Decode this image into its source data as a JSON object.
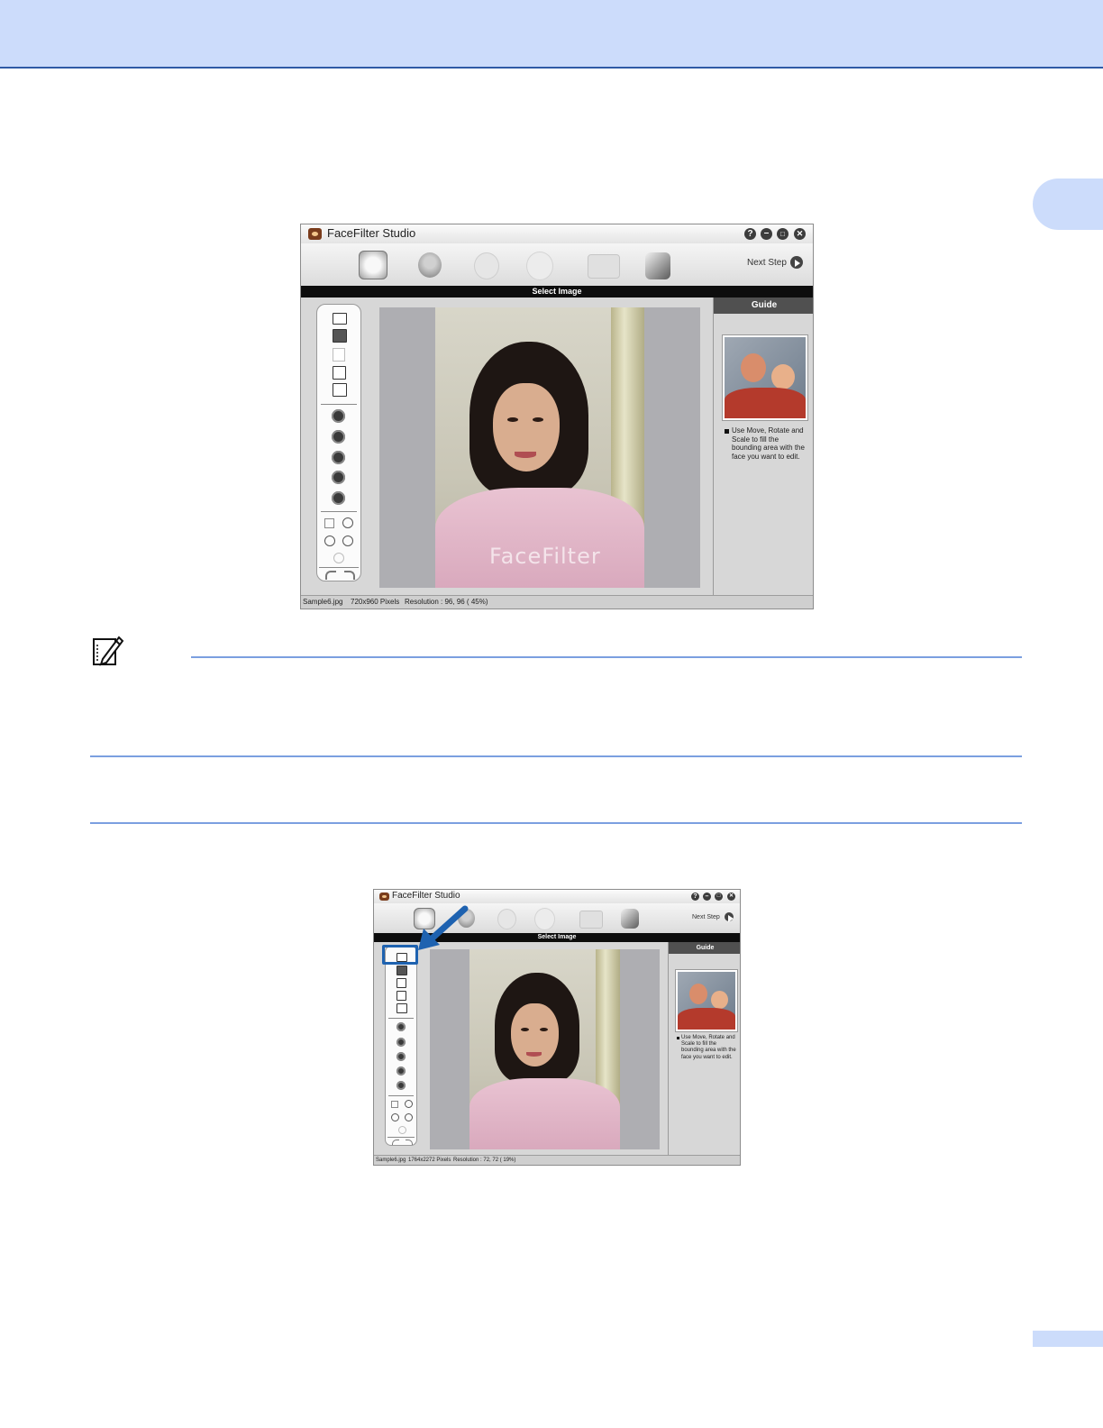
{
  "app": {
    "title": "FaceFilter Studio",
    "next_step": "Next Step",
    "section_title": "Select Image",
    "guide_header": "Guide",
    "guide_text": "Use Move, Rotate and Scale to fill the bounding area with the face you want to edit.",
    "watermark": "FaceFilter"
  },
  "screenshot1": {
    "status": {
      "file": "Sample6.jpg",
      "pixels": "720x960 Pixels",
      "resolution": "Resolution : 96, 96 ( 45%)"
    }
  },
  "screenshot2": {
    "status": {
      "file": "Sample6.jpg",
      "pixels": "1764x2272 Pixels",
      "resolution": "Resolution : 72, 72 ( 19%)"
    }
  },
  "icons": {
    "help": "help-icon",
    "minimize": "minimize-icon",
    "maximize": "maximize-icon",
    "close": "close-icon"
  }
}
